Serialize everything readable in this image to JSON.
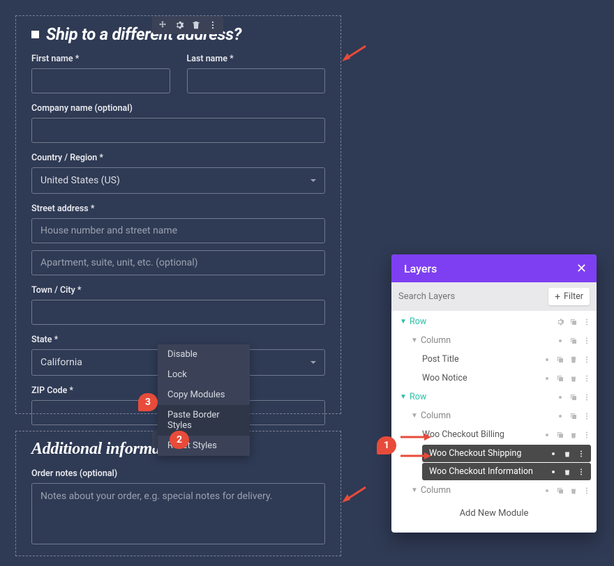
{
  "shipping": {
    "title": "Ship to a different address?",
    "first_name_label": "First name",
    "last_name_label": "Last name",
    "company_label": "Company name (optional)",
    "country_label": "Country / Region",
    "country_value": "United States (US)",
    "street_label": "Street address",
    "street_ph1": "House number and street name",
    "street_ph2": "Apartment, suite, unit, etc. (optional)",
    "city_label": "Town / City",
    "state_label": "State",
    "state_value": "California",
    "zip_label": "ZIP Code"
  },
  "additional": {
    "title": "Additional information",
    "notes_label": "Order notes (optional)",
    "notes_ph": "Notes about your order, e.g. special notes for delivery."
  },
  "context_menu": {
    "items": [
      "Disable",
      "Lock",
      "Copy Modules",
      "Paste Border Styles",
      "Reset Styles"
    ]
  },
  "badge1": "1",
  "badge2": "2",
  "badge3": "3",
  "layers": {
    "title": "Layers",
    "search_ph": "Search Layers",
    "filter": "Filter",
    "nodes": {
      "row0": "Row",
      "col0": "Column",
      "post_title": "Post Title",
      "woo_notice": "Woo Notice",
      "row1": "Row",
      "col1": "Column",
      "billing": "Woo Checkout Billing",
      "shipping": "Woo Checkout Shipping",
      "info": "Woo Checkout Information",
      "col2": "Column",
      "add_new": "Add New Module"
    }
  }
}
